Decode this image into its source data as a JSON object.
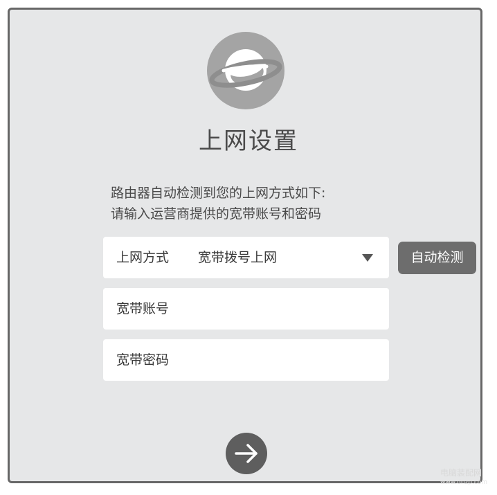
{
  "logo": {
    "icon": "planet-icon"
  },
  "title": "上网设置",
  "description": {
    "line1": "路由器自动检测到您的上网方式如下:",
    "line2": "请输入运营商提供的宽带账号和密码"
  },
  "connection_type": {
    "label": "上网方式",
    "value": "宽带拨号上网",
    "icon": "dropdown-arrow-icon"
  },
  "auto_detect_label": "自动检测",
  "account_field": {
    "placeholder": "宽带账号"
  },
  "password_field": {
    "placeholder": "宽带密码"
  },
  "next_button": {
    "icon": "arrow-right-icon"
  },
  "watermark": {
    "text": "电脑装配网",
    "url": "www.dnzp.com"
  }
}
